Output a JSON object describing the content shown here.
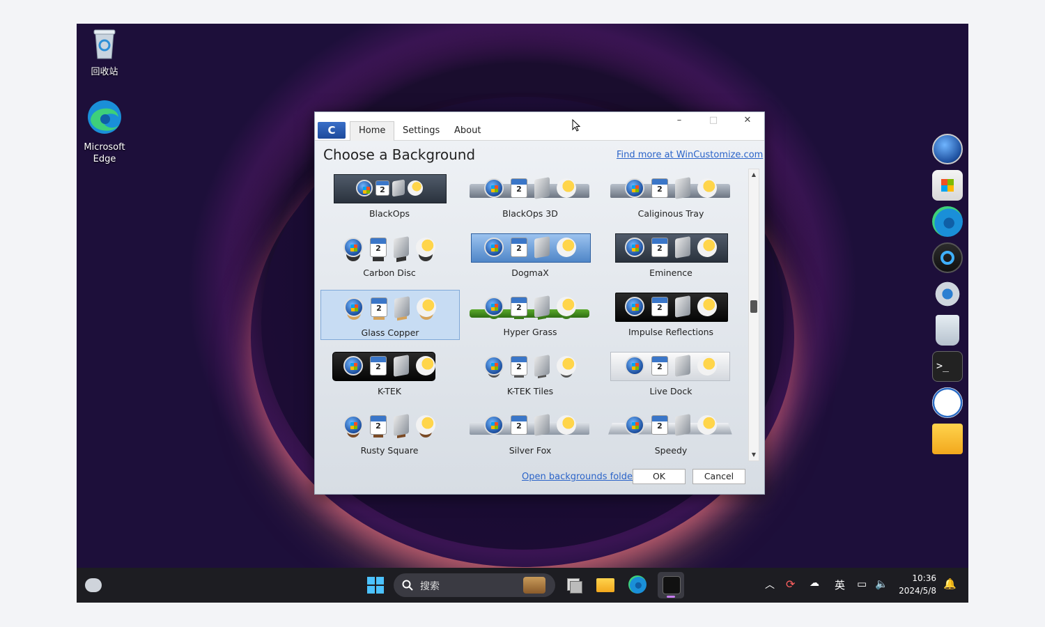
{
  "desktop": {
    "icons": [
      {
        "label": "回收站"
      },
      {
        "label_line1": "Microsoft",
        "label_line2": "Edge"
      }
    ]
  },
  "window": {
    "app_badge": "C",
    "tabs": [
      {
        "label": "Home"
      },
      {
        "label": "Settings"
      },
      {
        "label": "About"
      }
    ],
    "controls": {
      "minimize": "–",
      "maximize": "□",
      "close": "✕"
    },
    "heading": "Choose a Background",
    "find_more_link": "Find more at WinCustomize.com",
    "backgrounds": [
      {
        "name": "BlackOps",
        "selected": false
      },
      {
        "name": "BlackOps 3D",
        "selected": false
      },
      {
        "name": "Caliginous Tray",
        "selected": false
      },
      {
        "name": "Carbon Disc",
        "selected": false
      },
      {
        "name": "DogmaX",
        "selected": false
      },
      {
        "name": "Eminence",
        "selected": false
      },
      {
        "name": "Glass Copper",
        "selected": true
      },
      {
        "name": "Hyper Grass",
        "selected": false
      },
      {
        "name": "Impulse Reflections",
        "selected": false
      },
      {
        "name": "K-TEK",
        "selected": false
      },
      {
        "name": "K-TEK Tiles",
        "selected": false
      },
      {
        "name": "Live Dock",
        "selected": false
      },
      {
        "name": "Rusty Square",
        "selected": false
      },
      {
        "name": "Silver Fox",
        "selected": false
      },
      {
        "name": "Speedy",
        "selected": false
      }
    ],
    "open_folder_link": "Open backgrounds folder",
    "ok_label": "OK",
    "cancel_label": "Cancel"
  },
  "taskbar": {
    "search_placeholder": "搜索",
    "ime": "英",
    "time": "10:36",
    "date": "2024/5/8"
  },
  "colors": {
    "link": "#2a63c8",
    "selection": "#c7dcf3",
    "taskbar": "#1d1d22"
  }
}
